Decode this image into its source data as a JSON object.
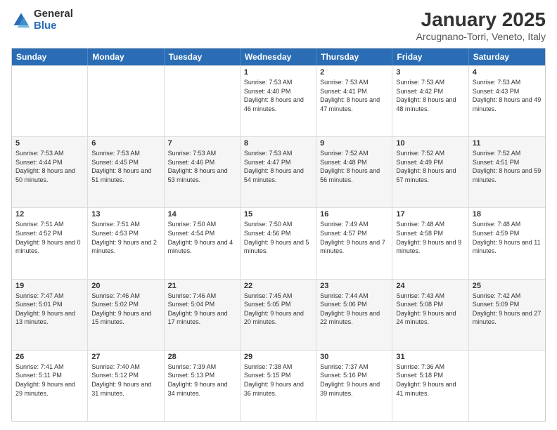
{
  "logo": {
    "general": "General",
    "blue": "Blue"
  },
  "title": "January 2025",
  "location": "Arcugnano-Torri, Veneto, Italy",
  "header_days": [
    "Sunday",
    "Monday",
    "Tuesday",
    "Wednesday",
    "Thursday",
    "Friday",
    "Saturday"
  ],
  "weeks": [
    [
      {
        "day": "",
        "text": ""
      },
      {
        "day": "",
        "text": ""
      },
      {
        "day": "",
        "text": ""
      },
      {
        "day": "1",
        "text": "Sunrise: 7:53 AM\nSunset: 4:40 PM\nDaylight: 8 hours and 46 minutes."
      },
      {
        "day": "2",
        "text": "Sunrise: 7:53 AM\nSunset: 4:41 PM\nDaylight: 8 hours and 47 minutes."
      },
      {
        "day": "3",
        "text": "Sunrise: 7:53 AM\nSunset: 4:42 PM\nDaylight: 8 hours and 48 minutes."
      },
      {
        "day": "4",
        "text": "Sunrise: 7:53 AM\nSunset: 4:43 PM\nDaylight: 8 hours and 49 minutes."
      }
    ],
    [
      {
        "day": "5",
        "text": "Sunrise: 7:53 AM\nSunset: 4:44 PM\nDaylight: 8 hours and 50 minutes."
      },
      {
        "day": "6",
        "text": "Sunrise: 7:53 AM\nSunset: 4:45 PM\nDaylight: 8 hours and 51 minutes."
      },
      {
        "day": "7",
        "text": "Sunrise: 7:53 AM\nSunset: 4:46 PM\nDaylight: 8 hours and 53 minutes."
      },
      {
        "day": "8",
        "text": "Sunrise: 7:53 AM\nSunset: 4:47 PM\nDaylight: 8 hours and 54 minutes."
      },
      {
        "day": "9",
        "text": "Sunrise: 7:52 AM\nSunset: 4:48 PM\nDaylight: 8 hours and 56 minutes."
      },
      {
        "day": "10",
        "text": "Sunrise: 7:52 AM\nSunset: 4:49 PM\nDaylight: 8 hours and 57 minutes."
      },
      {
        "day": "11",
        "text": "Sunrise: 7:52 AM\nSunset: 4:51 PM\nDaylight: 8 hours and 59 minutes."
      }
    ],
    [
      {
        "day": "12",
        "text": "Sunrise: 7:51 AM\nSunset: 4:52 PM\nDaylight: 9 hours and 0 minutes."
      },
      {
        "day": "13",
        "text": "Sunrise: 7:51 AM\nSunset: 4:53 PM\nDaylight: 9 hours and 2 minutes."
      },
      {
        "day": "14",
        "text": "Sunrise: 7:50 AM\nSunset: 4:54 PM\nDaylight: 9 hours and 4 minutes."
      },
      {
        "day": "15",
        "text": "Sunrise: 7:50 AM\nSunset: 4:56 PM\nDaylight: 9 hours and 5 minutes."
      },
      {
        "day": "16",
        "text": "Sunrise: 7:49 AM\nSunset: 4:57 PM\nDaylight: 9 hours and 7 minutes."
      },
      {
        "day": "17",
        "text": "Sunrise: 7:48 AM\nSunset: 4:58 PM\nDaylight: 9 hours and 9 minutes."
      },
      {
        "day": "18",
        "text": "Sunrise: 7:48 AM\nSunset: 4:59 PM\nDaylight: 9 hours and 11 minutes."
      }
    ],
    [
      {
        "day": "19",
        "text": "Sunrise: 7:47 AM\nSunset: 5:01 PM\nDaylight: 9 hours and 13 minutes."
      },
      {
        "day": "20",
        "text": "Sunrise: 7:46 AM\nSunset: 5:02 PM\nDaylight: 9 hours and 15 minutes."
      },
      {
        "day": "21",
        "text": "Sunrise: 7:46 AM\nSunset: 5:04 PM\nDaylight: 9 hours and 17 minutes."
      },
      {
        "day": "22",
        "text": "Sunrise: 7:45 AM\nSunset: 5:05 PM\nDaylight: 9 hours and 20 minutes."
      },
      {
        "day": "23",
        "text": "Sunrise: 7:44 AM\nSunset: 5:06 PM\nDaylight: 9 hours and 22 minutes."
      },
      {
        "day": "24",
        "text": "Sunrise: 7:43 AM\nSunset: 5:08 PM\nDaylight: 9 hours and 24 minutes."
      },
      {
        "day": "25",
        "text": "Sunrise: 7:42 AM\nSunset: 5:09 PM\nDaylight: 9 hours and 27 minutes."
      }
    ],
    [
      {
        "day": "26",
        "text": "Sunrise: 7:41 AM\nSunset: 5:11 PM\nDaylight: 9 hours and 29 minutes."
      },
      {
        "day": "27",
        "text": "Sunrise: 7:40 AM\nSunset: 5:12 PM\nDaylight: 9 hours and 31 minutes."
      },
      {
        "day": "28",
        "text": "Sunrise: 7:39 AM\nSunset: 5:13 PM\nDaylight: 9 hours and 34 minutes."
      },
      {
        "day": "29",
        "text": "Sunrise: 7:38 AM\nSunset: 5:15 PM\nDaylight: 9 hours and 36 minutes."
      },
      {
        "day": "30",
        "text": "Sunrise: 7:37 AM\nSunset: 5:16 PM\nDaylight: 9 hours and 39 minutes."
      },
      {
        "day": "31",
        "text": "Sunrise: 7:36 AM\nSunset: 5:18 PM\nDaylight: 9 hours and 41 minutes."
      },
      {
        "day": "",
        "text": ""
      }
    ]
  ]
}
